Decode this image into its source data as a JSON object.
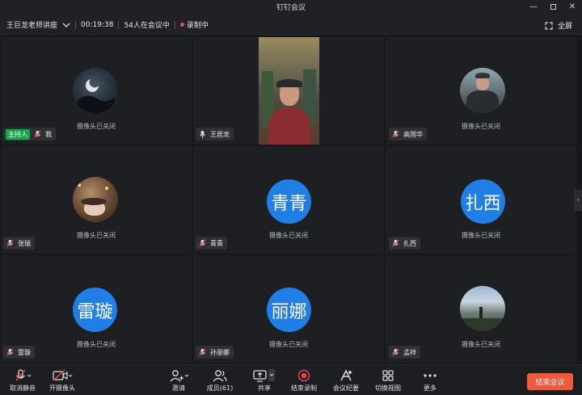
{
  "window": {
    "title": "钉钉会议"
  },
  "infobar": {
    "meeting_name": "王巨龙老师讲座",
    "duration": "00:19:38",
    "participants_status": "54人在会议中",
    "recording_status": "录制中",
    "fullscreen_label": "全屏"
  },
  "tiles": [
    {
      "name": "我",
      "host_badge": "主持人",
      "camera_status": "摄像头已关闭"
    },
    {
      "name": "王居龙"
    },
    {
      "name": "高国华",
      "camera_status": "摄像头已关闭"
    },
    {
      "name": "张瑞",
      "camera_status": "摄像头已关闭"
    },
    {
      "name": "青青",
      "avatar_text": "青青",
      "camera_status": "摄像头已关闭"
    },
    {
      "name": "扎西",
      "avatar_text": "扎西",
      "camera_status": "摄像头已关闭"
    },
    {
      "name": "雷璇",
      "avatar_text": "雷璇",
      "camera_status": "摄像头已关闭"
    },
    {
      "name": "孙丽娜",
      "avatar_text": "丽娜",
      "camera_status": "摄像头已关闭"
    },
    {
      "name": "孟祥",
      "camera_status": "摄像头已关闭"
    }
  ],
  "toolbar": {
    "unmute": "取消静音",
    "camera": "开摄像头",
    "invite": "邀请",
    "members": "成员(61)",
    "share": "共享",
    "end_recording": "结束录制",
    "minutes": "会议纪要",
    "switch_view": "切换视图",
    "more": "更多",
    "end_meeting": "结束会议"
  },
  "colors": {
    "accent": "#1f7fe6",
    "host": "#17a34a",
    "recording": "#f04848",
    "end_meeting": "#ee5a3c"
  }
}
